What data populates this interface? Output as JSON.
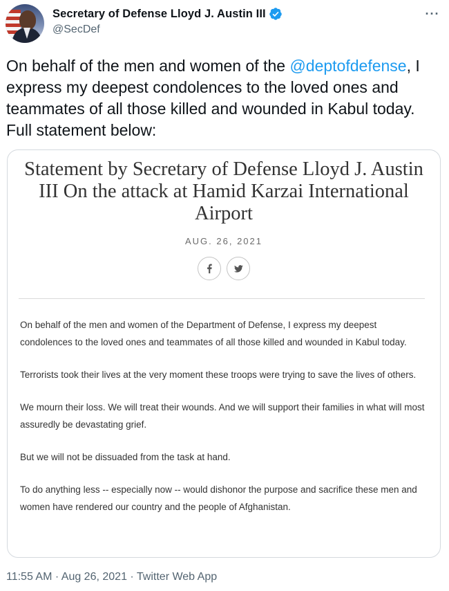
{
  "author": {
    "display_name": "Secretary of Defense Lloyd J. Austin III",
    "handle": "@SecDef",
    "verified": true,
    "avatar_icon": "avatar-photo"
  },
  "menu": {
    "more_label": "···"
  },
  "tweet": {
    "text_before": "On behalf of the men and women of the ",
    "mention": "@deptofdefense",
    "text_after": ", I express my deepest condolences to the loved ones and teammates of all those killed and wounded in Kabul today. Full statement below:"
  },
  "statement": {
    "title": "Statement by Secretary of Defense Lloyd J. Austin III On the attack at Hamid Karzai International Airport",
    "date": "AUG. 26, 2021",
    "share": {
      "facebook_label": "f",
      "twitter_label": "🐦"
    },
    "paragraphs": [
      "On behalf of the men and women of the Department of Defense, I express my deepest condolences to the loved ones and teammates of all those killed and wounded in Kabul today.",
      "Terrorists took their lives at the very moment these troops were trying to save the lives of others.",
      "We mourn their loss.  We will treat their wounds.  And we will support their families in what will most assuredly be devastating grief.",
      "But we will not be dissuaded from the task at hand.",
      "To do anything less -- especially now -- would dishonor the purpose and sacrifice these men and women have rendered our country and the people of Afghanistan."
    ]
  },
  "meta": {
    "time": "11:55 AM",
    "date": "Aug 26, 2021",
    "source": "Twitter Web App",
    "separator": " · "
  },
  "colors": {
    "link": "#1d9bf0",
    "secondary_text": "#536471",
    "verified_badge": "#1d9bf0"
  }
}
